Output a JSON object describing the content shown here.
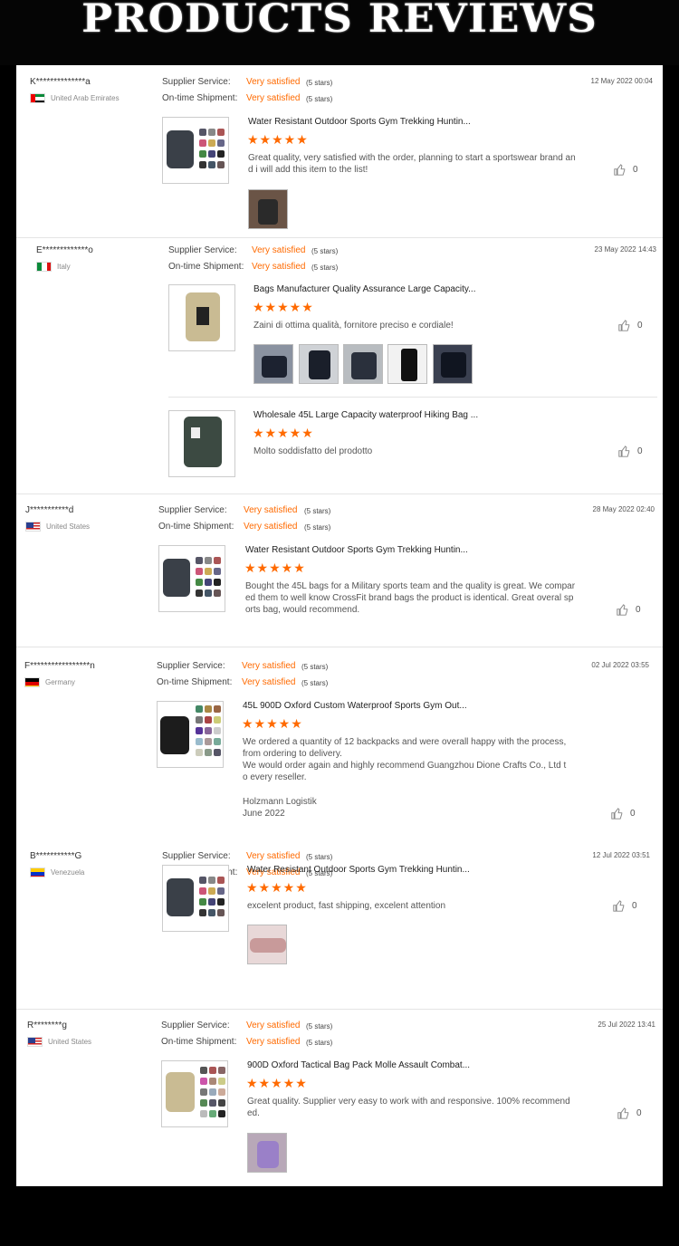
{
  "page": {
    "banner_title": "PRODUCTS REVIEWS"
  },
  "labels": {
    "supplier_service": "Supplier Service:",
    "on_time_shipment": "On-time Shipment:",
    "very_satisfied": "Very satisfied",
    "five_stars": "(5 stars)"
  },
  "colors": {
    "accent": "#ff6a00",
    "background": "#000000",
    "panel": "#ffffff"
  },
  "rating_glyph": "★★★★★",
  "reviews": [
    {
      "user": "K**************a",
      "country": "United Arab Emirates",
      "date": "12 May 2022 00:04",
      "items": [
        {
          "title": "Water Resistant Outdoor Sports Gym Trekking Huntin...",
          "comment": "Great quality, very satisfied with the order, planning to start a sportswear brand and i will add this item to the list!",
          "likes": "0"
        }
      ]
    },
    {
      "user": "E*************o",
      "country": "Italy",
      "date": "23 May 2022 14:43",
      "items": [
        {
          "title": "Bags Manufacturer Quality Assurance Large Capacity...",
          "comment": "Zaini di ottima qualità, fornitore preciso e cordiale!",
          "likes": "0"
        },
        {
          "title": "Wholesale 45L Large Capacity waterproof Hiking Bag ...",
          "comment": "Molto soddisfatto del prodotto",
          "likes": "0"
        }
      ]
    },
    {
      "user": "J***********d",
      "country": "United States",
      "date": "28 May 2022 02:40",
      "items": [
        {
          "title": "Water Resistant Outdoor Sports Gym Trekking Huntin...",
          "comment": "Bought the 45L bags for a Military sports team and the quality is great. We compared them to well know CrossFit brand bags the product is identical. Great overal sports bag, would recommend.",
          "likes": "0"
        }
      ]
    },
    {
      "user": "F*****************n",
      "country": "Germany",
      "date": "02 Jul 2022 03:55",
      "items": [
        {
          "title": "45L 900D Oxford Custom Waterproof Sports Gym Out...",
          "comment": "We ordered a quantity of 12 backpacks and were overall happy with the process, from ordering to delivery.",
          "comment2": "We would order again and highly recommend Guangzhou Dione Crafts Co., Ltd to every reseller.",
          "signature": "Holzmann Logistik",
          "signature_date": "June 2022",
          "likes": "0"
        }
      ]
    },
    {
      "user": "B***********G",
      "country": "Venezuela",
      "date": "12 Jul 2022 03:51",
      "items": [
        {
          "title": "Water Resistant Outdoor Sports Gym Trekking Huntin...",
          "comment": "excelent product, fast shipping, excelent attention",
          "likes": "0"
        }
      ]
    },
    {
      "user": "R********g",
      "country": "United States",
      "date": "25 Jul 2022 13:41",
      "items": [
        {
          "title": "900D Oxford Tactical Bag Pack Molle Assault Combat...",
          "comment": "Great quality. Supplier very easy to work with and responsive. 100% recommended.",
          "likes": "0"
        }
      ]
    }
  ]
}
